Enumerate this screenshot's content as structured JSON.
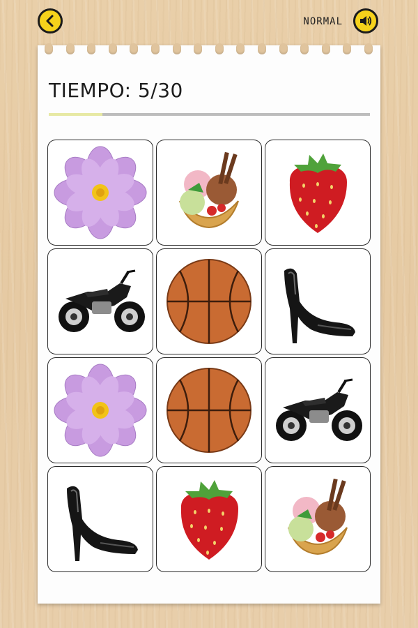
{
  "header": {
    "back_icon": "back-arrow-icon",
    "difficulty": "NORMAL",
    "sound_icon": "speaker-icon"
  },
  "timer": {
    "label": "TIEMPO: 5/30",
    "progress": 0.1667
  },
  "cards": [
    {
      "item": "flower"
    },
    {
      "item": "ice-cream"
    },
    {
      "item": "strawberry"
    },
    {
      "item": "motorcycle"
    },
    {
      "item": "basketball"
    },
    {
      "item": "high-heel"
    },
    {
      "item": "flower"
    },
    {
      "item": "basketball"
    },
    {
      "item": "motorcycle"
    },
    {
      "item": "high-heel"
    },
    {
      "item": "strawberry"
    },
    {
      "item": "ice-cream"
    }
  ],
  "colors": {
    "button": "#f6d21b",
    "progress_fill": "#e7e9a4",
    "progress_track": "#bdbdbd"
  }
}
